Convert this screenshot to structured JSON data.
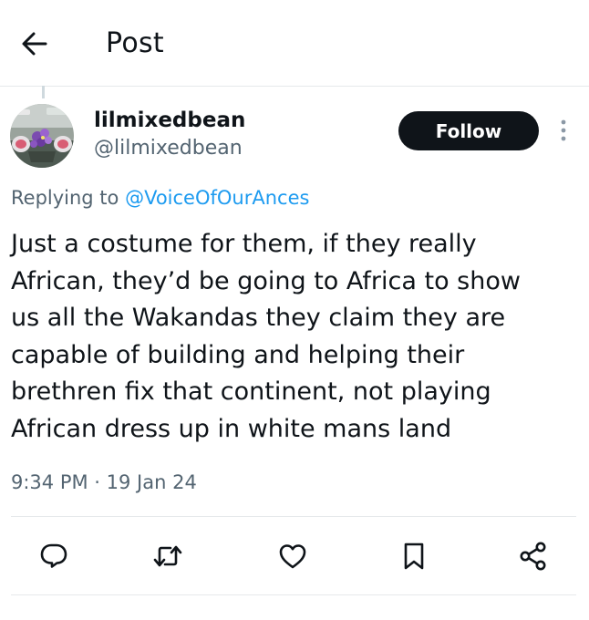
{
  "header": {
    "title": "Post",
    "back_icon": "arrow-left-icon"
  },
  "author": {
    "display_name": "lilmixedbean",
    "handle": "@lilmixedbean",
    "follow_label": "Follow",
    "more_icon": "more-vertical-icon"
  },
  "reply": {
    "prefix": "Replying to ",
    "mention": "@VoiceOfOurAnces"
  },
  "tweet": {
    "text": "Just a costume for them, if they really\nAfrican, they’d be going to Africa to show\nus all the Wakandas they claim they are\ncapable of building and helping their\nbrethren fix that continent, not playing\nAfrican dress up in white mans land",
    "timestamp": "9:34 PM · 19 Jan 24"
  },
  "actions": [
    {
      "icon": "reply-icon"
    },
    {
      "icon": "retweet-icon"
    },
    {
      "icon": "like-icon"
    },
    {
      "icon": "bookmark-icon"
    },
    {
      "icon": "share-icon"
    }
  ],
  "colors": {
    "text": "#0f1419",
    "secondary": "#536471",
    "link": "#1d9bf0",
    "divider": "#e6e9eb",
    "button": "#0f1419"
  }
}
